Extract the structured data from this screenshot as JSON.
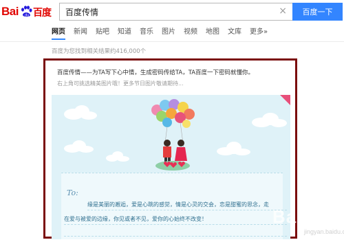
{
  "header": {
    "logo_text_left": "Bai",
    "logo_text_right": "百度",
    "search_value": "百度传情",
    "clear_glyph": "×",
    "search_button": "百度一下"
  },
  "tabs": [
    {
      "label": "网页",
      "active": true
    },
    {
      "label": "新闻",
      "active": false
    },
    {
      "label": "贴吧",
      "active": false
    },
    {
      "label": "知道",
      "active": false
    },
    {
      "label": "音乐",
      "active": false
    },
    {
      "label": "图片",
      "active": false
    },
    {
      "label": "视频",
      "active": false
    },
    {
      "label": "地图",
      "active": false
    },
    {
      "label": "文库",
      "active": false
    },
    {
      "label": "更多»",
      "active": false
    }
  ],
  "result_count": "百度为您找到相关结果约416,000个",
  "card": {
    "title": "百度传情——为TA写下心中情，生成密码传给TA，TA百度一下密码就懂你。",
    "subtitle": "右上角可挑选精美图片哦！更多节日图片敬请期待...",
    "letter": {
      "to_label": "To:",
      "line1": "缘是美丽的邂逅，爱是心跳的感觉，情是心灵的交会，恋是甜蜜的思念，走",
      "line2": "在爱与被爱的边缘，你见或者不见，爱你的心始终不改变！"
    }
  },
  "watermark": {
    "text": "Bai",
    "url": "jingyan.baidu.com"
  },
  "colors": {
    "brand_red": "#e10602",
    "brand_blue": "#3385ff",
    "card_border": "#7a0a0a",
    "illustration_bg": "#dff2f8"
  }
}
